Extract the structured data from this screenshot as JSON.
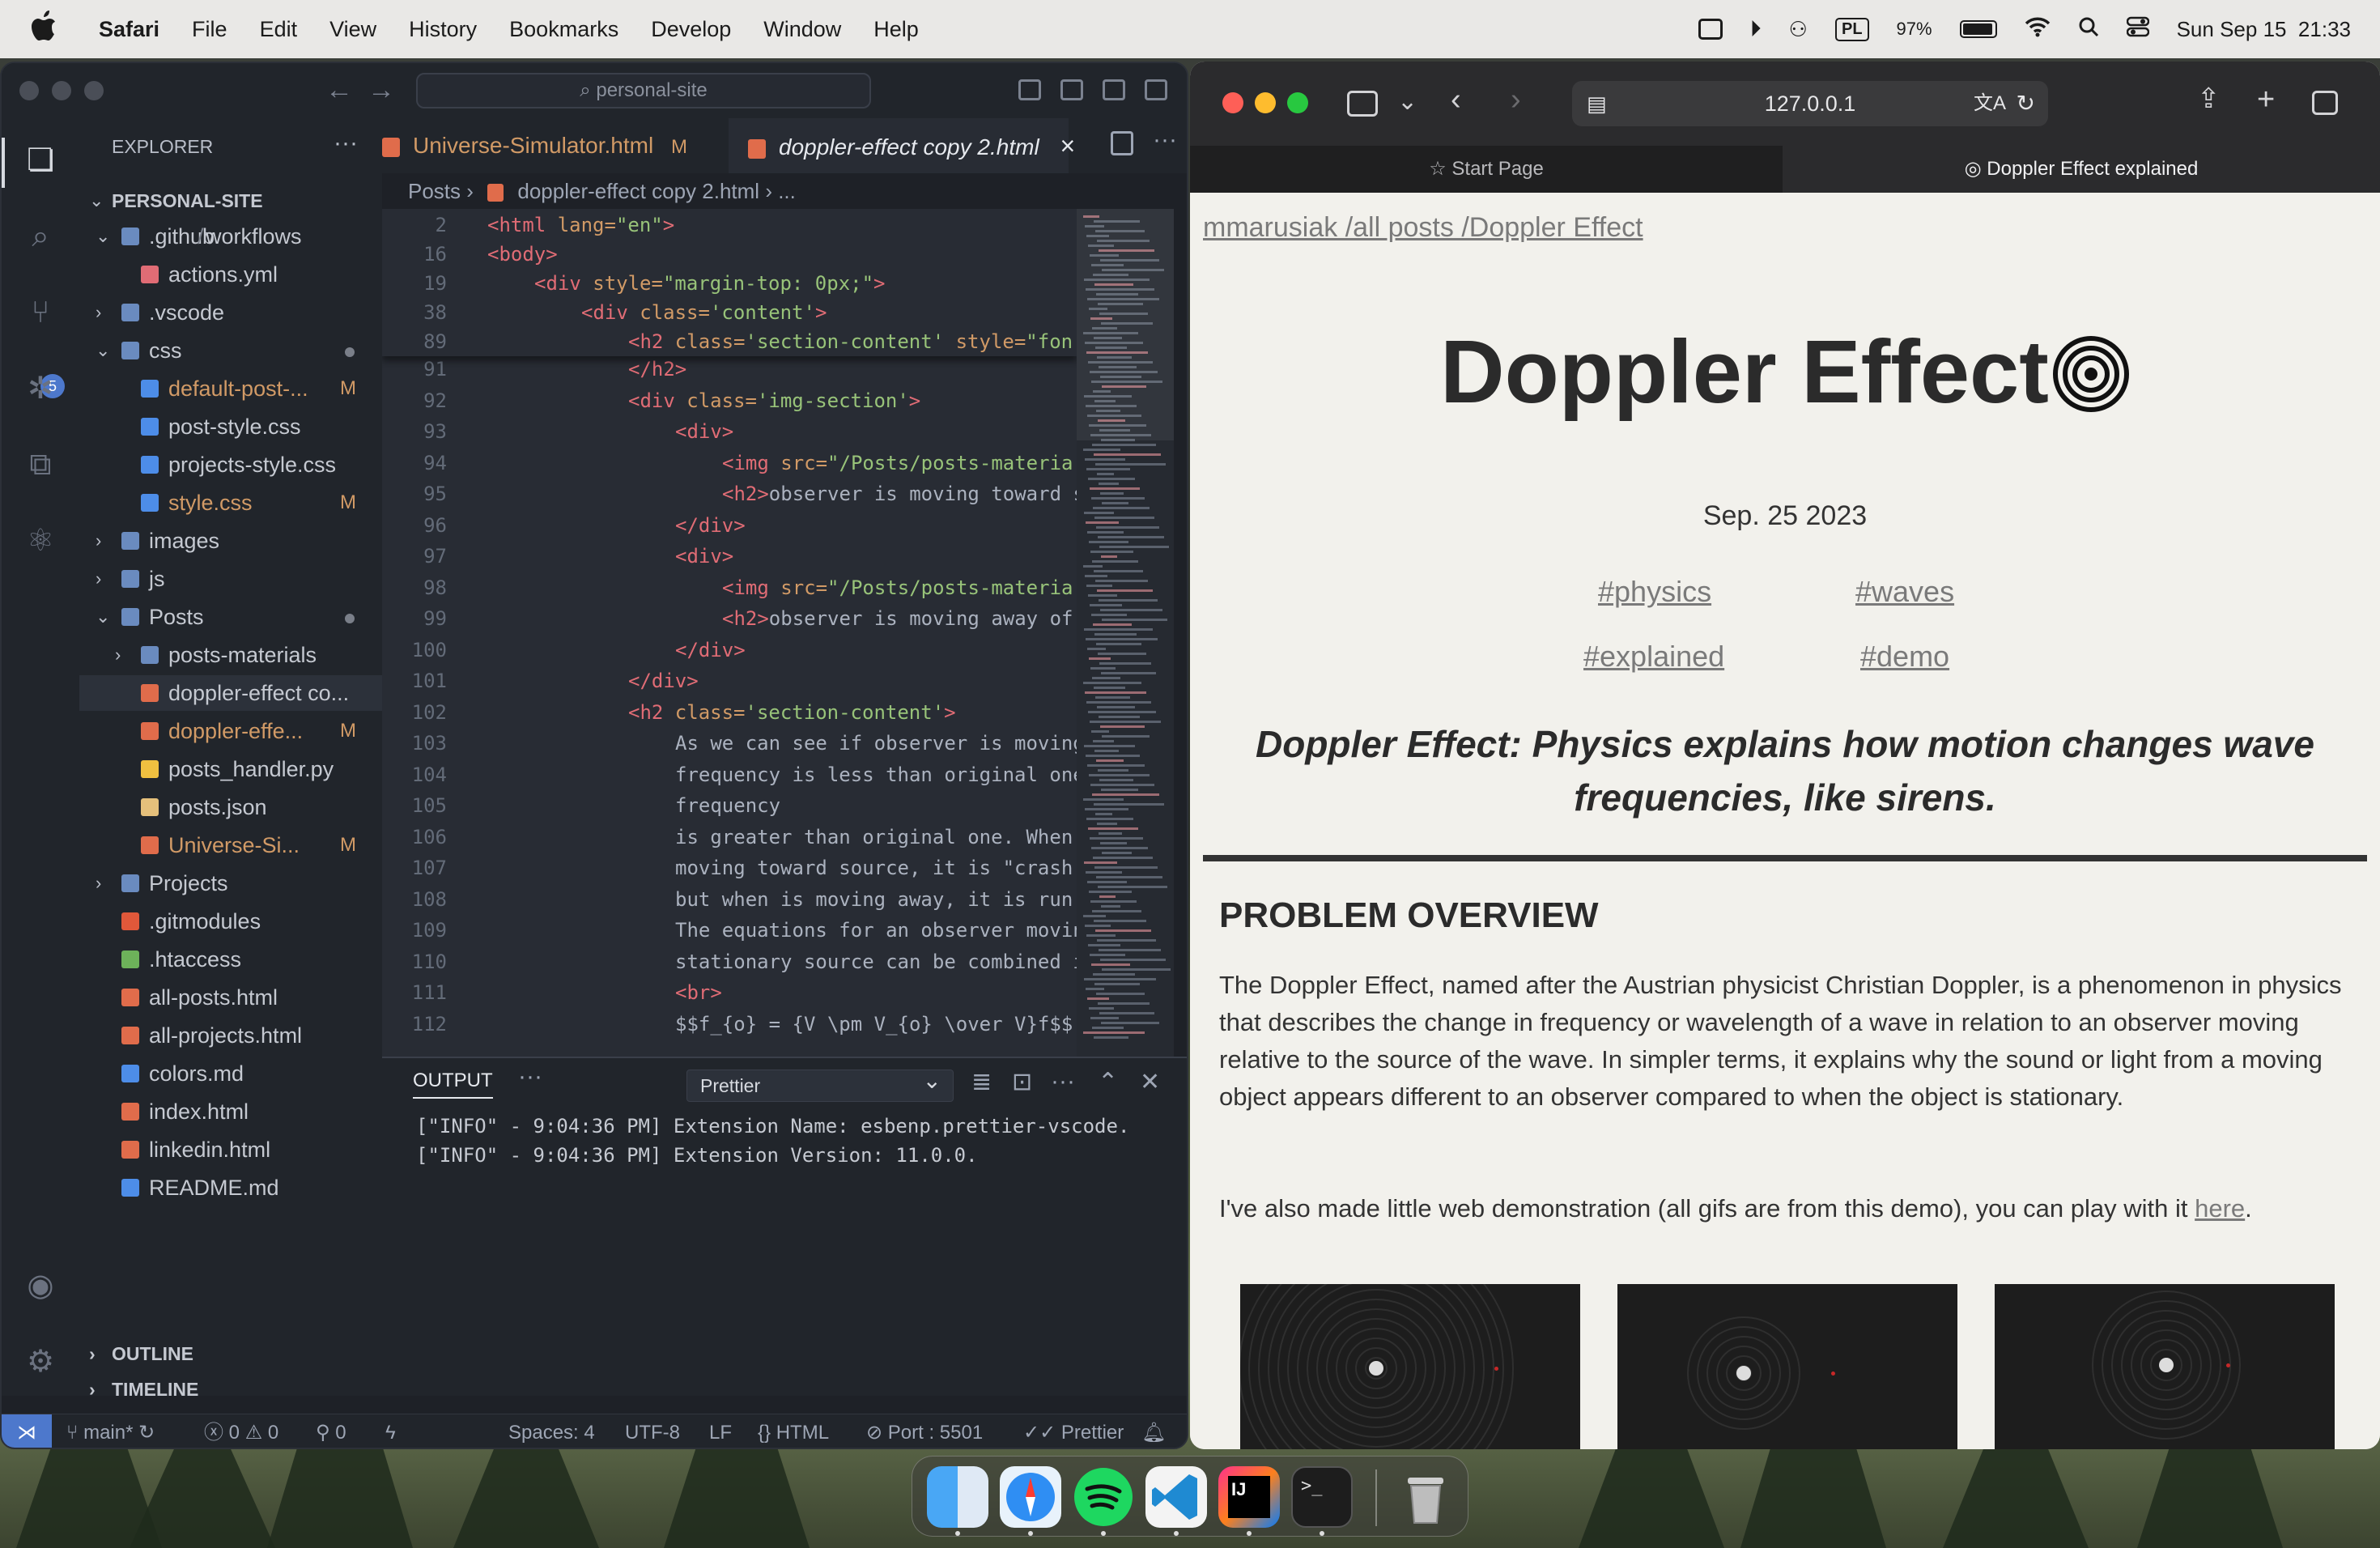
{
  "menubar": {
    "apple_icon": "apple-logo",
    "items": [
      "Safari",
      "File",
      "Edit",
      "View",
      "History",
      "Bookmarks",
      "Develop",
      "Window",
      "Help"
    ],
    "status": {
      "keyboard_layout": "PL",
      "battery": "97%",
      "datetime": "Sun Sep 15  21:33"
    }
  },
  "vscode": {
    "search_placeholder": "personal-site",
    "explorer_title": "EXPLORER",
    "root": "PERSONAL-SITE",
    "tree": [
      {
        "label": ".github",
        "extra": "workflows",
        "expanded": true,
        "depth": 0,
        "type": "folder"
      },
      {
        "label": "actions.yml",
        "depth": 1,
        "type": "yml"
      },
      {
        "label": ".vscode",
        "depth": 0,
        "type": "folder"
      },
      {
        "label": "css",
        "depth": 0,
        "type": "folder",
        "expanded": true,
        "dot": true
      },
      {
        "label": "default-post-...",
        "depth": 1,
        "type": "css",
        "status": "M"
      },
      {
        "label": "post-style.css",
        "depth": 1,
        "type": "css"
      },
      {
        "label": "projects-style.css",
        "depth": 1,
        "type": "css"
      },
      {
        "label": "style.css",
        "depth": 1,
        "type": "css",
        "status": "M"
      },
      {
        "label": "images",
        "depth": 0,
        "type": "folder"
      },
      {
        "label": "js",
        "depth": 0,
        "type": "folder"
      },
      {
        "label": "Posts",
        "depth": 0,
        "type": "folder",
        "expanded": true,
        "dot": true
      },
      {
        "label": "posts-materials",
        "depth": 1,
        "type": "folder"
      },
      {
        "label": "doppler-effect co...",
        "depth": 1,
        "type": "html",
        "selected": true
      },
      {
        "label": "doppler-effe...",
        "depth": 1,
        "type": "html",
        "status": "M"
      },
      {
        "label": "posts_handler.py",
        "depth": 1,
        "type": "py"
      },
      {
        "label": "posts.json",
        "depth": 1,
        "type": "json"
      },
      {
        "label": "Universe-Si...",
        "depth": 1,
        "type": "html",
        "status": "M"
      },
      {
        "label": "Projects",
        "depth": 0,
        "type": "folder"
      },
      {
        "label": ".gitmodules",
        "depth": 0,
        "type": "git"
      },
      {
        "label": ".htaccess",
        "depth": 0,
        "type": "file"
      },
      {
        "label": "all-posts.html",
        "depth": 0,
        "type": "html"
      },
      {
        "label": "all-projects.html",
        "depth": 0,
        "type": "html"
      },
      {
        "label": "colors.md",
        "depth": 0,
        "type": "md"
      },
      {
        "label": "index.html",
        "depth": 0,
        "type": "html"
      },
      {
        "label": "linkedin.html",
        "depth": 0,
        "type": "html"
      },
      {
        "label": "README.md",
        "depth": 0,
        "type": "info"
      }
    ],
    "outline_label": "OUTLINE",
    "timeline_label": "TIMELINE",
    "tabs": [
      {
        "label": "Universe-Simulator.html",
        "status": "M"
      },
      {
        "label": "doppler-effect copy 2.html",
        "close": "×"
      }
    ],
    "breadcrumb": [
      "Posts",
      "doppler-effect copy 2.html",
      "..."
    ],
    "sticky_lines": [
      {
        "n": "2",
        "indent": 0,
        "parts": [
          [
            "tg",
            "<html "
          ],
          [
            "at",
            "lang="
          ],
          [
            "st",
            "\"en\""
          ],
          [
            "tg",
            ">"
          ]
        ]
      },
      {
        "n": "16",
        "indent": 0,
        "parts": [
          [
            "tg",
            "<body>"
          ]
        ]
      },
      {
        "n": "19",
        "indent": 1,
        "parts": [
          [
            "tg",
            "<div "
          ],
          [
            "at",
            "style="
          ],
          [
            "st",
            "\"margin-top: 0px;\""
          ],
          [
            "tg",
            ">"
          ]
        ]
      },
      {
        "n": "38",
        "indent": 2,
        "parts": [
          [
            "tg",
            "<div "
          ],
          [
            "at",
            "class="
          ],
          [
            "st",
            "'content'"
          ],
          [
            "tg",
            ">"
          ]
        ]
      },
      {
        "n": "89",
        "indent": 3,
        "parts": [
          [
            "tg",
            "<h2 "
          ],
          [
            "at",
            "class="
          ],
          [
            "st",
            "'section-content' "
          ],
          [
            "at",
            "style="
          ],
          [
            "st",
            "\"fon"
          ]
        ]
      }
    ],
    "code_lines": [
      {
        "n": "91",
        "indent": 3,
        "parts": [
          [
            "tg",
            "</h2>"
          ]
        ]
      },
      {
        "n": "92",
        "indent": 3,
        "parts": [
          [
            "tg",
            "<div "
          ],
          [
            "at",
            "class="
          ],
          [
            "st",
            "'img-section'"
          ],
          [
            "tg",
            ">"
          ]
        ]
      },
      {
        "n": "93",
        "indent": 4,
        "parts": [
          [
            "tg",
            "<div>"
          ]
        ]
      },
      {
        "n": "94",
        "indent": 5,
        "parts": [
          [
            "tg",
            "<img "
          ],
          [
            "at",
            "src="
          ],
          [
            "st",
            "\"/Posts/posts-materia"
          ]
        ]
      },
      {
        "n": "95",
        "indent": 5,
        "parts": [
          [
            "tg",
            "<h2>"
          ],
          [
            "tx",
            "observer is moving toward s"
          ]
        ]
      },
      {
        "n": "96",
        "indent": 4,
        "parts": [
          [
            "tg",
            "</div>"
          ]
        ]
      },
      {
        "n": "97",
        "indent": 4,
        "parts": [
          [
            "tg",
            "<div>"
          ]
        ]
      },
      {
        "n": "98",
        "indent": 5,
        "parts": [
          [
            "tg",
            "<img "
          ],
          [
            "at",
            "src="
          ],
          [
            "st",
            "\"/Posts/posts-materia"
          ]
        ]
      },
      {
        "n": "99",
        "indent": 5,
        "parts": [
          [
            "tg",
            "<h2>"
          ],
          [
            "tx",
            "observer is moving away of"
          ]
        ]
      },
      {
        "n": "100",
        "indent": 4,
        "parts": [
          [
            "tg",
            "</div>"
          ]
        ]
      },
      {
        "n": "101",
        "indent": 3,
        "parts": [
          [
            "tg",
            "</div>"
          ]
        ]
      },
      {
        "n": "102",
        "indent": 3,
        "parts": [
          [
            "tg",
            "<h2 "
          ],
          [
            "at",
            "class="
          ],
          [
            "st",
            "'section-content'"
          ],
          [
            "tg",
            ">"
          ]
        ]
      },
      {
        "n": "103",
        "indent": 4,
        "parts": [
          [
            "tx",
            "As we can see if observer is moving"
          ]
        ]
      },
      {
        "n": "104",
        "indent": 4,
        "parts": [
          [
            "tx",
            "frequency is less than original one"
          ]
        ]
      },
      {
        "n": "105",
        "indent": 4,
        "parts": [
          [
            "tx",
            "frequency"
          ]
        ]
      },
      {
        "n": "106",
        "indent": 4,
        "parts": [
          [
            "tx",
            "is greater than original one. When"
          ]
        ]
      },
      {
        "n": "107",
        "indent": 4,
        "parts": [
          [
            "tx",
            "moving toward source, it is \"crash"
          ]
        ]
      },
      {
        "n": "108",
        "indent": 4,
        "parts": [
          [
            "tx",
            "but when is moving away, it is run"
          ]
        ]
      },
      {
        "n": "109",
        "indent": 4,
        "parts": [
          [
            "tx",
            "The equations for an observer movin"
          ]
        ]
      },
      {
        "n": "110",
        "indent": 4,
        "parts": [
          [
            "tx",
            "stationary source can be combined i"
          ]
        ]
      },
      {
        "n": "111",
        "indent": 4,
        "parts": [
          [
            "tg",
            "<br>"
          ]
        ]
      },
      {
        "n": "112",
        "indent": 4,
        "parts": [
          [
            "tx",
            "$$f_{o} = {V \\pm V_{o} \\over V}f$$"
          ]
        ]
      }
    ],
    "panel": {
      "title": "OUTPUT",
      "dots": "···",
      "channel": "Prettier",
      "lines": [
        "[\"INFO\" - 9:04:36 PM] Extension Name: esbenp.prettier-vscode.",
        "[\"INFO\" - 9:04:36 PM] Extension Version: 11.0.0."
      ]
    },
    "statusbar": {
      "branch": "main*",
      "errors": "0",
      "warnings": "0",
      "ports": "0",
      "spaces": "Spaces: 4",
      "encoding": "UTF-8",
      "eol": "LF",
      "language": "HTML",
      "port": "Port : 5501",
      "formatter": "Prettier"
    }
  },
  "safari": {
    "url": "127.0.0.1",
    "tabs": [
      {
        "label": "Start Page"
      },
      {
        "label": "Doppler Effect explained"
      }
    ],
    "page": {
      "crumb": "mmarusiak /all posts /Doppler Effect",
      "title": "Doppler Effect",
      "date": "Sep. 25 2023",
      "tags": [
        "#physics",
        "#waves",
        "#explained",
        "#demo"
      ],
      "lead": "Doppler Effect: Physics explains how motion changes wave frequencies, like sirens.",
      "section_title": "PROBLEM OVERVIEW",
      "paragraph1": "The Doppler Effect, named after the Austrian physicist Christian Doppler, is a phenomenon in physics that describes the change in frequency or wavelength of a wave in relation to an observer moving relative to the source of the wave. In simpler terms, it explains why the sound or light from a moving object appears different to an observer compared to when the object is stationary.",
      "paragraph2_prefix": "I've also made little web demonstration (all gifs are from this demo), you can play with it ",
      "paragraph2_link": "here",
      "paragraph2_suffix": "."
    }
  },
  "dock": {
    "apps": [
      "finder-icon",
      "safari-icon",
      "spotify-icon",
      "vscode-icon",
      "intellij-icon",
      "terminal-icon",
      "trash-icon"
    ]
  }
}
